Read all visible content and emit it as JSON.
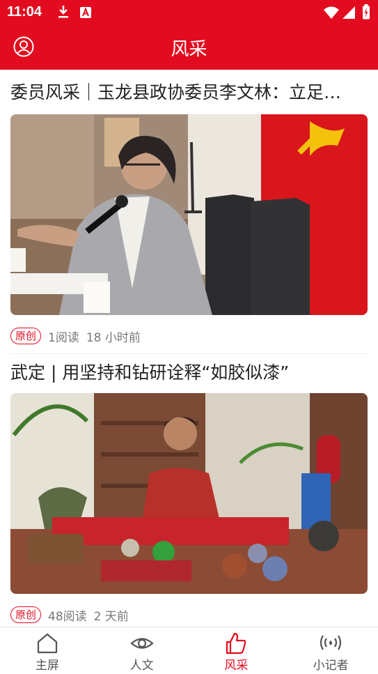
{
  "status_bar": {
    "time": "11:04"
  },
  "header": {
    "title": "风采"
  },
  "articles": [
    {
      "title": "委员风采｜玉龙县政协委员李文林：立足…",
      "badge": "原创",
      "reads": "1阅读",
      "time_ago": "18 小时前"
    },
    {
      "title": "武定 | 用坚持和钻研诠释“如胶似漆”",
      "badge": "原创",
      "reads": "48阅读",
      "time_ago": "2 天前"
    }
  ],
  "tabs": [
    {
      "label": "主屏",
      "icon": "home-icon",
      "active": false
    },
    {
      "label": "人文",
      "icon": "eye-icon",
      "active": false
    },
    {
      "label": "风采",
      "icon": "thumbs-up-icon",
      "active": true
    },
    {
      "label": "小记者",
      "icon": "broadcast-icon",
      "active": false
    }
  ],
  "colors": {
    "brand": "#e20b1f",
    "text": "#222222",
    "muted": "#777777"
  }
}
